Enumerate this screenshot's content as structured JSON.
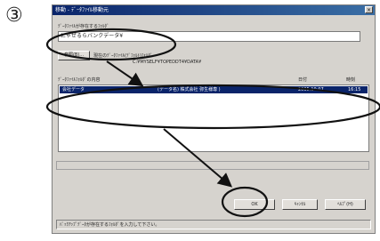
{
  "step_marker": "③",
  "dialog": {
    "title": "移動 - ﾃﾞｰﾀﾌｧｲﾙ移動元",
    "close_glyph": "×",
    "folder_label": "ﾃﾞｰﾀﾌｧｲﾙが存在するﾌｫﾙﾀﾞ",
    "folder_value": "にゃぜるらバンクデータ¥",
    "browse_button": "参照(B)...",
    "info_label": "現在のﾃﾞｰﾀﾌｧｲﾙ(ﾃﾞﾌｫﾙﾄ)ﾌｫﾙﾀﾞ",
    "info_path": "C:¥MYSELF¥TOPEDDT4¥DATA¥",
    "list_label": "ﾃﾞｰﾀﾌｧｲﾙﾌｫﾙﾀﾞの内容",
    "columns": {
      "date": "日付",
      "time": "時刻"
    },
    "rows": [
      {
        "name": "会社データ",
        "desc": "(データ名) 株式会社 弥生様専 )",
        "date": "2005.10.07",
        "time": "16:15"
      }
    ],
    "ok_button": "OK",
    "cancel_button": "ｷｬﾝｾﾙ",
    "help_button": "ﾍﾙﾌﾟ(H)",
    "status_text": "ﾊﾞｯｸｱｯﾌﾟﾃﾞｰﾀが存在するﾌｫﾙﾀﾞを入力して下さい。"
  }
}
